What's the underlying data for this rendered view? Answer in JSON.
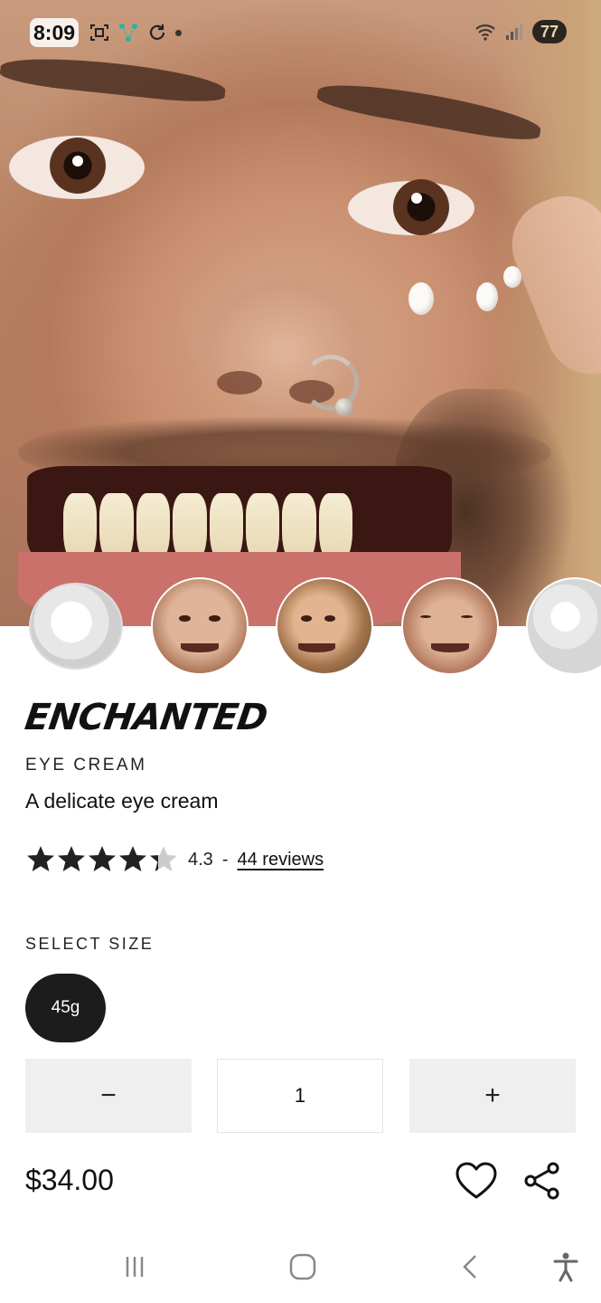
{
  "status_bar": {
    "time": "8:09",
    "battery": "77"
  },
  "hero": {
    "icon": "product-hero-photo"
  },
  "thumbnails": [
    {
      "icon": "cream-swatch-thumb"
    },
    {
      "icon": "model-eye-cream-thumb"
    },
    {
      "icon": "model-hand-face-thumb"
    },
    {
      "icon": "model-eyes-closed-thumb"
    },
    {
      "icon": "cream-texture-thumb"
    }
  ],
  "product": {
    "name": "ENCHANTED",
    "category": "EYE CREAM",
    "description": "A delicate eye cream",
    "rating_value": "4.3",
    "rating_fraction": 0.86,
    "rating_separator": "-",
    "reviews_label": "44 reviews"
  },
  "size": {
    "label": "SELECT SIZE",
    "options": [
      "45g"
    ],
    "selected": "45g"
  },
  "quantity": {
    "minus_label": "−",
    "value": "1",
    "plus_label": "+"
  },
  "price": "$34.00",
  "actions": {
    "wishlist_icon": "heart-icon",
    "share_icon": "share-icon"
  },
  "nav": {
    "recent_icon": "recent-apps-icon",
    "home_icon": "home-icon",
    "back_icon": "back-icon",
    "accessibility_icon": "accessibility-icon"
  },
  "colors": {
    "accent_dark": "#1c1c1c",
    "qty_button_bg": "#efefef",
    "star_filled": "#222222",
    "star_empty": "#cccccc"
  }
}
